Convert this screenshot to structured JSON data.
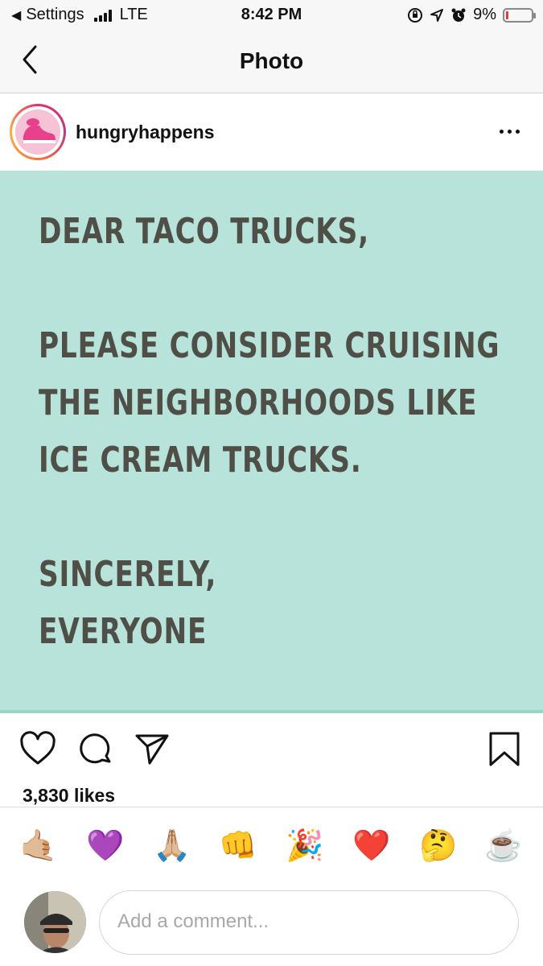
{
  "status_bar": {
    "back_app": "Settings",
    "network": "LTE",
    "time": "8:42 PM",
    "battery": "9%",
    "battery_level": 0.09
  },
  "nav": {
    "title": "Photo"
  },
  "post": {
    "username": "hungryhappens",
    "image_text": {
      "line1": "DEAR TACO TRUCKS,",
      "line2": "PLEASE CONSIDER CRUISING",
      "line3": "THE NEIGHBORHOODS LIKE",
      "line4": "ICE CREAM TRUCKS.",
      "line5": "SINCERELY,",
      "line6": "EVERYONE"
    },
    "likes": "3,830 likes"
  },
  "quick_reactions": [
    "🤙🏼",
    "💜",
    "🙏🏼",
    "👊",
    "🎉",
    "❤️",
    "🤔",
    "☕"
  ],
  "comment": {
    "placeholder": "Add a comment..."
  },
  "colors": {
    "post_background": "#b7e3da",
    "post_text": "#4f4f48",
    "battery_low": "#e53935"
  }
}
